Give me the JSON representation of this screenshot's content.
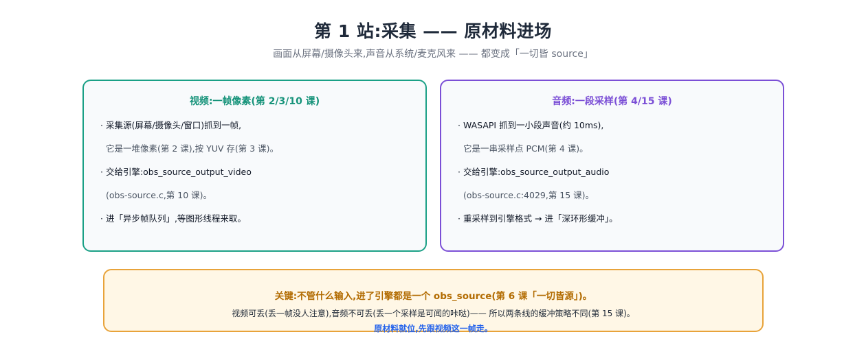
{
  "header": {
    "title": "第 1 站:采集 —— 原材料进场",
    "subtitle": "画面从屏幕/摄像头来,声音从系统/麦克风来 —— 都变成「一切皆 source」"
  },
  "video_card": {
    "title": "视频:一帧像素(第 2/3/10 课)",
    "lines": [
      "· 采集源(屏幕/摄像头/窗口)抓到一帧,",
      "它是一堆像素(第 2 课),按 YUV 存(第 3 课)。",
      "· 交给引擎:obs_source_output_video",
      "(obs-source.c,第 10 课)。",
      "· 进「异步帧队列」,等图形线程来取。"
    ]
  },
  "audio_card": {
    "title": "音频:一段采样(第 4/15 课)",
    "lines": [
      "· WASAPI 抓到一小段声音(约 10ms),",
      "它是一串采样点 PCM(第 4 课)。",
      "· 交给引擎:obs_source_output_audio",
      "(obs-source.c:4029,第 15 课)。",
      "· 重采样到引擎格式 → 进「深环形缓冲」。"
    ]
  },
  "key_box": {
    "title": "关键:不管什么输入,进了引擎都是一个 obs_source(第 6 课「一切皆源」)。",
    "body": "视频可丢(丢一帧没人注意),音频不可丢(丢一个采样是可闻的咔哒)—— 所以两条线的缓冲策略不同(第 15 课)。",
    "footer": "原材料就位,先跟视频这一帧走。"
  },
  "colors": {
    "video_accent": "#1aa086",
    "audio_accent": "#7b4fd6",
    "key_accent": "#e8a33a",
    "footer_link": "#2563eb"
  }
}
